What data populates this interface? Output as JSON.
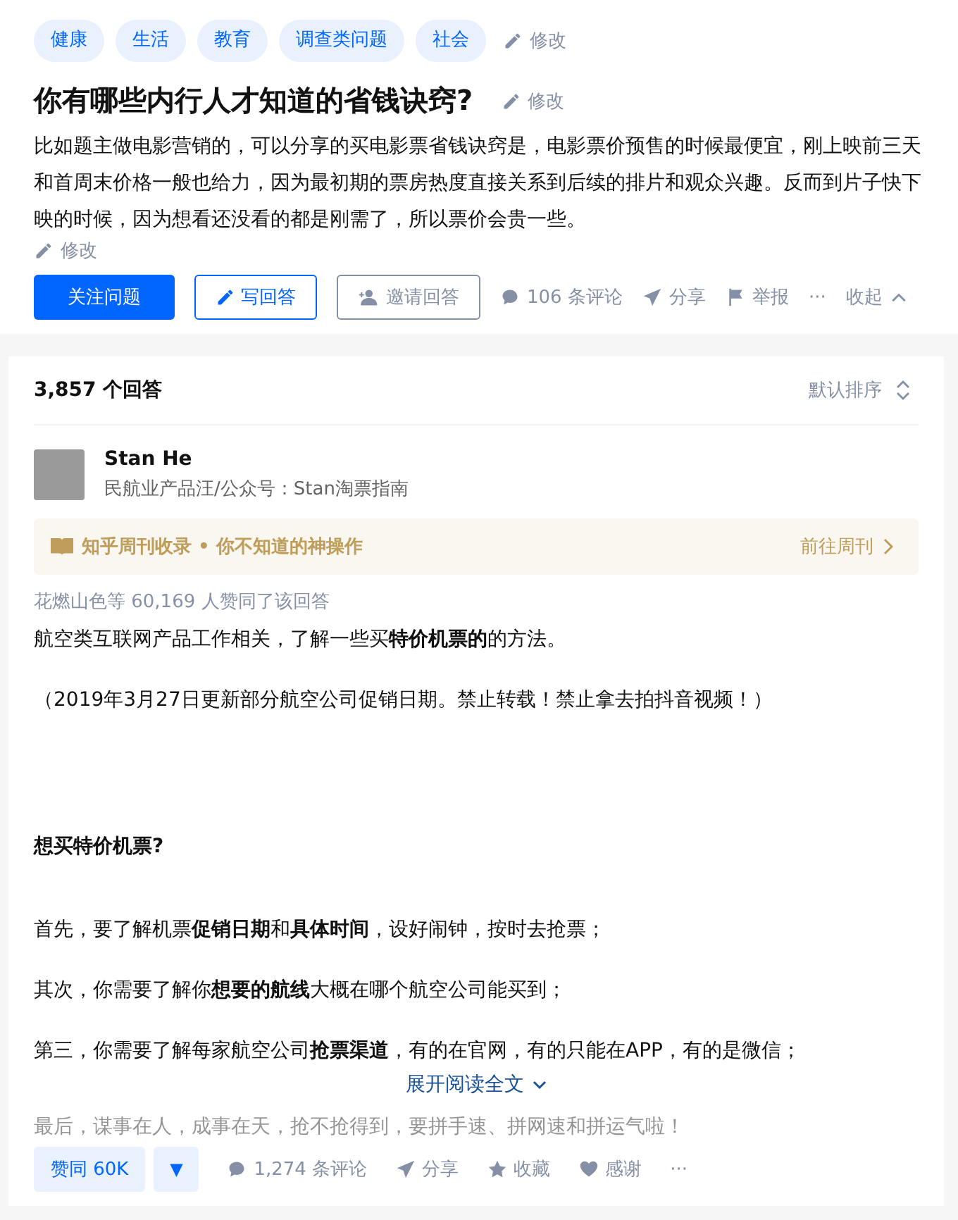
{
  "topics": [
    "健康",
    "生活",
    "教育",
    "调查类问题",
    "社会"
  ],
  "topic_edit": "修改",
  "question": {
    "title": "你有哪些内行人才知道的省钱诀窍?",
    "title_edit": "修改",
    "description": "比如题主做电影营销的，可以分享的买电影票省钱诀窍是，电影票价预售的时候最便宜，刚上映前三天和首周末价格一般也给力，因为最初期的票房热度直接关系到后续的排片和观众兴趣。反而到片子快下映的时候，因为想看还没看的都是刚需了，所以票价会贵一些。",
    "description_edit": "修改"
  },
  "question_actions": {
    "follow": "关注问题",
    "write": "写回答",
    "invite": "邀请回答",
    "comments": "106 条评论",
    "share": "分享",
    "report": "举报",
    "more": "···",
    "collapse": "收起"
  },
  "answers_header": {
    "count": "3,857 个回答",
    "sort": "默认排序"
  },
  "answer": {
    "author": "Stan He",
    "headline": "民航业产品汪/公众号：Stan淘票指南",
    "collection": {
      "label": "知乎周刊收录 • 你不知道的神操作",
      "link": "前往周刊"
    },
    "upvoters": "花燃山色等 60,169 人赞同了该回答",
    "paragraphs": [
      {
        "kind": "paragraph",
        "text": "航空类互联网产品工作相关，了解一些买**特价机票的**的方法。"
      },
      {
        "kind": "paragraph",
        "text": "（2019年3月27日更新部分航空公司促销日期。禁止转载！禁止拿去拍抖音视频！）"
      },
      {
        "kind": "heading",
        "text": "想买特价机票?"
      },
      {
        "kind": "paragraph",
        "text": "首先，要了解机票**促销日期**和**具体时间**，设好闹钟，按时去抢票；"
      },
      {
        "kind": "paragraph",
        "text": "其次，你需要了解你**想要的航线**大概在哪个航空公司能买到；"
      },
      {
        "kind": "paragraph",
        "text": "第三，你需要了解每家航空公司**抢票渠道**，有的在官网，有的只能在APP，有的是微信；"
      },
      {
        "kind": "expand",
        "text": "展开阅读全文"
      },
      {
        "kind": "faded",
        "text": "最后，谋事在人，成事在天，抢不抢得到，要拼手速、拼网速和拼运气啦！"
      }
    ],
    "actions": {
      "upvote": "赞同 60K",
      "downvote": "▼",
      "comments": "1,274 条评论",
      "share": "分享",
      "favorite": "收藏",
      "thanks": "感谢",
      "more": "···"
    }
  }
}
